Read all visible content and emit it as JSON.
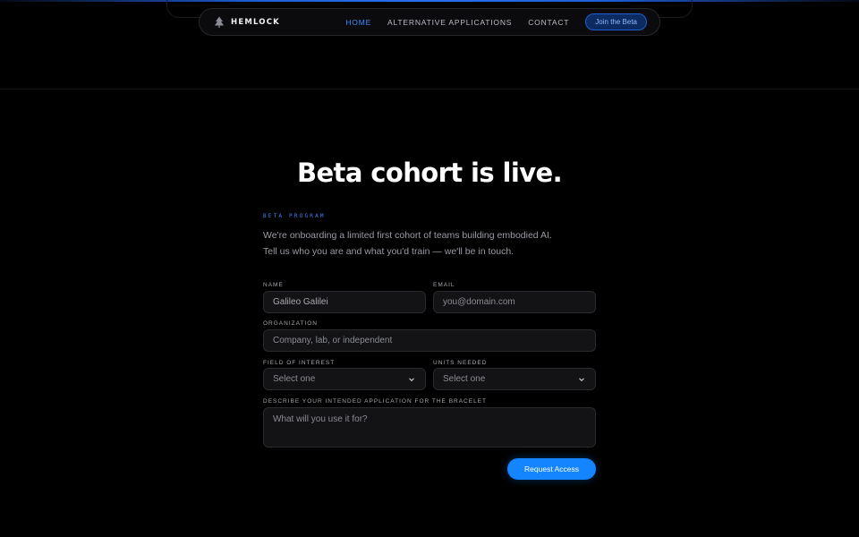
{
  "nav": {
    "brand": "HEMLOCK",
    "links": [
      {
        "label": "HOME",
        "active": true
      },
      {
        "label": "ALTERNATIVE APPLICATIONS",
        "active": false
      },
      {
        "label": "CONTACT",
        "active": false
      }
    ],
    "cta_label": "Join the Beta"
  },
  "hero": {
    "title": "Beta cohort is live."
  },
  "intro": {
    "eyebrow": "BETA PROGRAM",
    "line1": "We're onboarding a limited first cohort of teams building embodied AI.",
    "line2": "Tell us who you are and what you'd train — we'll be in touch."
  },
  "form": {
    "name": {
      "label": "NAME",
      "value": "Galileo Galilei"
    },
    "email": {
      "label": "EMAIL",
      "placeholder": "you@domain.com"
    },
    "organization": {
      "label": "ORGANIZATION",
      "placeholder": "Company, lab, or independent"
    },
    "field_of_interest": {
      "label": "FIELD OF INTEREST",
      "selected": "Select one"
    },
    "units_needed": {
      "label": "UNITS NEEDED",
      "selected": "Select one"
    },
    "application": {
      "label": "DESCRIBE YOUR INTENDED APPLICATION FOR THE BRACELET",
      "placeholder": "What will you use it for?"
    },
    "submit_label": "Request Access"
  },
  "colors": {
    "accent": "#1585ff",
    "eyebrow": "#3b82f6",
    "background": "#000000"
  },
  "icons": {
    "logo": "tree-icon",
    "select": "chevron-down-icon"
  }
}
